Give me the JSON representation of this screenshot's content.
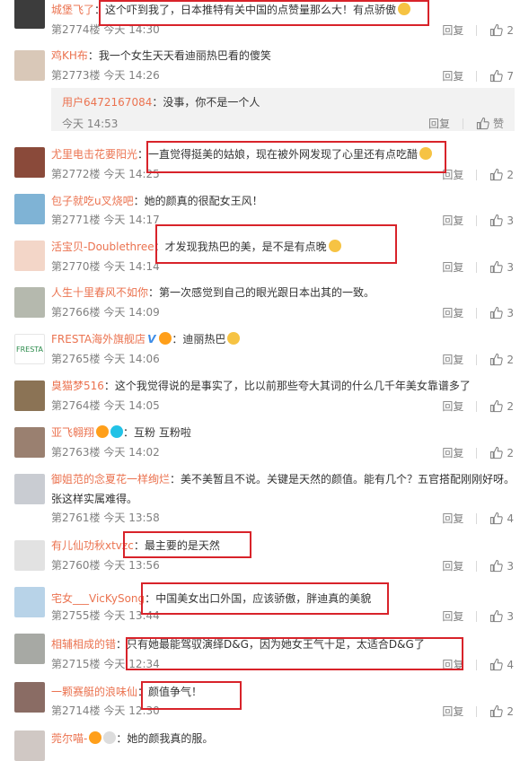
{
  "action_labels": {
    "reply": "回复",
    "like_text": "赞"
  },
  "accent_colors": {
    "username": "#eb7350",
    "highlight_box": "#d8232a"
  },
  "comments": [
    {
      "user": "城堡飞了",
      "text": "这个吓到我了，日本推特有关中国的点赞量那么大！有点骄傲",
      "floor": "第2774楼",
      "time": "今天 14:30",
      "likes": "2"
    },
    {
      "user": "鸡KH布",
      "text": "我一个女生天天看迪丽热巴看的傻笑",
      "floor": "第2773楼",
      "time": "今天 14:26",
      "likes": "7"
    },
    {
      "user": "尤里电击花要阳光",
      "text": "一直觉得挺美的姑娘，现在被外网发现了心里还有点吃醋",
      "floor": "第2772楼",
      "time": "今天 14:25",
      "likes": "2"
    },
    {
      "user": "包子就吃u叉烧吧",
      "text": "她的颜真的很配女王风！",
      "floor": "第2771楼",
      "time": "今天 14:17",
      "likes": "3"
    },
    {
      "user": "活宝贝-Doublethree",
      "text": "才发现我热巴的美，是不是有点晚",
      "floor": "第2770楼",
      "time": "今天 14:14",
      "likes": "3"
    },
    {
      "user": "人生十里春风不如你",
      "text": "第一次感觉到自己的眼光跟日本出其的一致。",
      "floor": "第2766楼",
      "time": "今天 14:09",
      "likes": "3"
    },
    {
      "user": "FRESTA海外旗舰店",
      "text": "迪丽热巴",
      "floor": "第2765楼",
      "time": "今天 14:06",
      "likes": "2"
    },
    {
      "user": "臭猫梦516",
      "text": "这个我觉得说的是事实了，比以前那些夸大其词的什么几千年美女靠谱多了",
      "floor": "第2764楼",
      "time": "今天 14:05",
      "likes": "2"
    },
    {
      "user": "亚飞翱翔",
      "text": "互粉 互粉啦",
      "floor": "第2763楼",
      "time": "今天 14:02",
      "likes": "2"
    },
    {
      "user": "御姐范的念夏花一样绚烂",
      "text": "美不美暂且不说。关键是天然的颜值。能有几个？五官搭配刚刚好呀。",
      "text2": "张这样实属难得。",
      "floor": "第2761楼",
      "time": "今天 13:58",
      "likes": "4"
    },
    {
      "user": "有儿仙功秋xtvzc",
      "text": "最主要的是天然",
      "floor": "第2760楼",
      "time": "今天 13:56",
      "likes": "3"
    },
    {
      "user": "宅女___VicKySong",
      "text": "中国美女出口外国，应该骄傲，胖迪真的美貌",
      "floor": "第2755楼",
      "time": "今天 13:44",
      "likes": "3"
    },
    {
      "user": "相辅相成的错",
      "text": "只有她最能驾驭演绎D&G，因为她女王气十足，太适合D&G了",
      "floor": "第2715楼",
      "time": "今天 12:34",
      "likes": "4"
    },
    {
      "user": "一颗赛艇的浪味仙",
      "text": "颜值争气！",
      "floor": "第2714楼",
      "time": "今天 12:30",
      "likes": "2"
    },
    {
      "user": "莞尔喵-",
      "text": "她的颜我真的服。"
    }
  ],
  "sub_reply": {
    "user": "用户6472167084",
    "text": "没事，你不是一个人",
    "time": "今天 14:53"
  }
}
